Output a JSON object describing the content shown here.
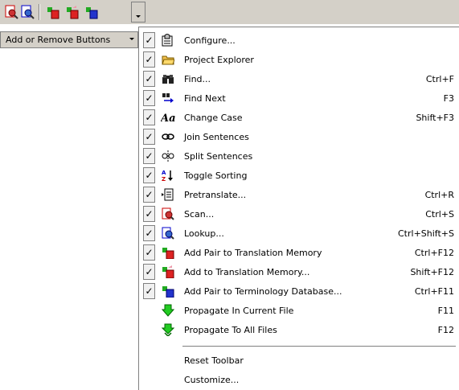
{
  "colors": {
    "toolbar_bg": "#d4d0c8",
    "check_bg": "#f0f0f0"
  },
  "toolbar": {
    "buttons": [
      {
        "icon": "scan-icon"
      },
      {
        "icon": "lookup-icon"
      },
      {
        "icon": "add-pair-tm-icon"
      },
      {
        "icon": "add-tm-icon"
      },
      {
        "icon": "add-pair-termdb-icon"
      }
    ]
  },
  "add_remove": {
    "label": "Add or Remove Buttons"
  },
  "menu": {
    "items": [
      {
        "label": "Configure...",
        "shortcut": "",
        "checked": true,
        "icon": "configure-icon"
      },
      {
        "label": "Project Explorer",
        "shortcut": "",
        "checked": true,
        "icon": "folder-icon"
      },
      {
        "label": "Find...",
        "shortcut": "Ctrl+F",
        "checked": true,
        "icon": "binoculars-icon"
      },
      {
        "label": "Find Next",
        "shortcut": "F3",
        "checked": true,
        "icon": "find-next-icon"
      },
      {
        "label": "Change Case",
        "shortcut": "Shift+F3",
        "checked": true,
        "icon": "change-case-icon"
      },
      {
        "label": "Join Sentences",
        "shortcut": "",
        "checked": true,
        "icon": "join-icon"
      },
      {
        "label": "Split Sentences",
        "shortcut": "",
        "checked": true,
        "icon": "split-icon"
      },
      {
        "label": "Toggle Sorting",
        "shortcut": "",
        "checked": true,
        "icon": "sort-icon"
      },
      {
        "label": "Pretranslate...",
        "shortcut": "Ctrl+R",
        "checked": true,
        "icon": "pretranslate-icon"
      },
      {
        "label": "Scan...",
        "shortcut": "Ctrl+S",
        "checked": true,
        "icon": "scan-icon"
      },
      {
        "label": "Lookup...",
        "shortcut": "Ctrl+Shift+S",
        "checked": true,
        "icon": "lookup-icon"
      },
      {
        "label": "Add Pair to Translation Memory",
        "shortcut": "Ctrl+F12",
        "checked": true,
        "icon": "add-pair-tm-icon"
      },
      {
        "label": "Add to Translation Memory...",
        "shortcut": "Shift+F12",
        "checked": true,
        "icon": "add-tm-icon"
      },
      {
        "label": "Add Pair to Terminology Database...",
        "shortcut": "Ctrl+F11",
        "checked": true,
        "icon": "add-pair-termdb-icon"
      },
      {
        "label": "Propagate In Current File",
        "shortcut": "F11",
        "checked": false,
        "icon": "propagate-icon"
      },
      {
        "label": "Propagate To All Files",
        "shortcut": "F12",
        "checked": false,
        "icon": "propagate-all-icon"
      }
    ],
    "footer": [
      {
        "label": "Reset Toolbar"
      },
      {
        "label": "Customize..."
      }
    ]
  }
}
